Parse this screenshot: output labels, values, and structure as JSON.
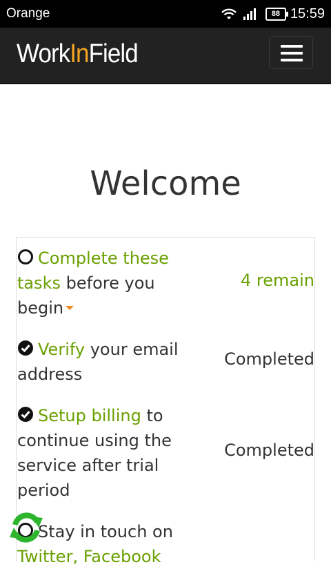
{
  "statusbar": {
    "carrier": "Orange",
    "battery": "88",
    "time": "15:59",
    "icons": [
      "wifi-icon",
      "signal-icon",
      "battery-icon"
    ]
  },
  "navbar": {
    "brand_part1": "Work",
    "brand_part2": "In",
    "brand_part3": "Field",
    "menu_icon": "hamburger-menu-icon"
  },
  "page": {
    "title": "Welcome"
  },
  "tasks": [
    {
      "icon": "circle-open-icon",
      "link": "Complete these tasks",
      "rest": " before you begin",
      "status": "4 remain",
      "status_is_link": true
    },
    {
      "icon": "check-circle-icon",
      "link": "Verify",
      "rest": " your email address",
      "status": "Completed"
    },
    {
      "icon": "check-circle-icon",
      "link": "Setup billing",
      "rest": " to continue using the service after trial period",
      "status": "Completed"
    },
    {
      "icon": "circle-open-icon",
      "rest": "Stay in touch on",
      "link": "Twitter, Facebook"
    }
  ],
  "floating": {
    "icon": "sync-icon"
  },
  "colors": {
    "accent_link": "#6aa000",
    "brand_highlight": "#f5a623",
    "navbar_bg": "#222222",
    "sync_green": "#2db52d"
  }
}
